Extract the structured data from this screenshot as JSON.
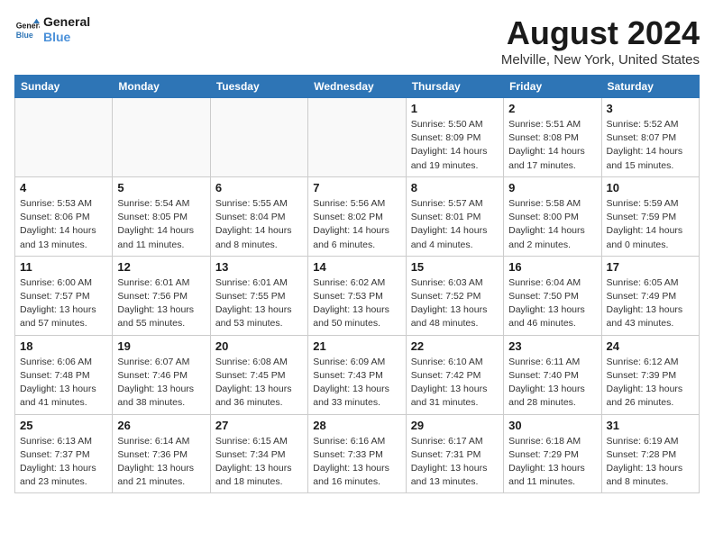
{
  "header": {
    "logo_line1": "General",
    "logo_line2": "Blue",
    "title": "August 2024",
    "subtitle": "Melville, New York, United States"
  },
  "weekdays": [
    "Sunday",
    "Monday",
    "Tuesday",
    "Wednesday",
    "Thursday",
    "Friday",
    "Saturday"
  ],
  "weeks": [
    [
      {
        "day": "",
        "info": ""
      },
      {
        "day": "",
        "info": ""
      },
      {
        "day": "",
        "info": ""
      },
      {
        "day": "",
        "info": ""
      },
      {
        "day": "1",
        "info": "Sunrise: 5:50 AM\nSunset: 8:09 PM\nDaylight: 14 hours\nand 19 minutes."
      },
      {
        "day": "2",
        "info": "Sunrise: 5:51 AM\nSunset: 8:08 PM\nDaylight: 14 hours\nand 17 minutes."
      },
      {
        "day": "3",
        "info": "Sunrise: 5:52 AM\nSunset: 8:07 PM\nDaylight: 14 hours\nand 15 minutes."
      }
    ],
    [
      {
        "day": "4",
        "info": "Sunrise: 5:53 AM\nSunset: 8:06 PM\nDaylight: 14 hours\nand 13 minutes."
      },
      {
        "day": "5",
        "info": "Sunrise: 5:54 AM\nSunset: 8:05 PM\nDaylight: 14 hours\nand 11 minutes."
      },
      {
        "day": "6",
        "info": "Sunrise: 5:55 AM\nSunset: 8:04 PM\nDaylight: 14 hours\nand 8 minutes."
      },
      {
        "day": "7",
        "info": "Sunrise: 5:56 AM\nSunset: 8:02 PM\nDaylight: 14 hours\nand 6 minutes."
      },
      {
        "day": "8",
        "info": "Sunrise: 5:57 AM\nSunset: 8:01 PM\nDaylight: 14 hours\nand 4 minutes."
      },
      {
        "day": "9",
        "info": "Sunrise: 5:58 AM\nSunset: 8:00 PM\nDaylight: 14 hours\nand 2 minutes."
      },
      {
        "day": "10",
        "info": "Sunrise: 5:59 AM\nSunset: 7:59 PM\nDaylight: 14 hours\nand 0 minutes."
      }
    ],
    [
      {
        "day": "11",
        "info": "Sunrise: 6:00 AM\nSunset: 7:57 PM\nDaylight: 13 hours\nand 57 minutes."
      },
      {
        "day": "12",
        "info": "Sunrise: 6:01 AM\nSunset: 7:56 PM\nDaylight: 13 hours\nand 55 minutes."
      },
      {
        "day": "13",
        "info": "Sunrise: 6:01 AM\nSunset: 7:55 PM\nDaylight: 13 hours\nand 53 minutes."
      },
      {
        "day": "14",
        "info": "Sunrise: 6:02 AM\nSunset: 7:53 PM\nDaylight: 13 hours\nand 50 minutes."
      },
      {
        "day": "15",
        "info": "Sunrise: 6:03 AM\nSunset: 7:52 PM\nDaylight: 13 hours\nand 48 minutes."
      },
      {
        "day": "16",
        "info": "Sunrise: 6:04 AM\nSunset: 7:50 PM\nDaylight: 13 hours\nand 46 minutes."
      },
      {
        "day": "17",
        "info": "Sunrise: 6:05 AM\nSunset: 7:49 PM\nDaylight: 13 hours\nand 43 minutes."
      }
    ],
    [
      {
        "day": "18",
        "info": "Sunrise: 6:06 AM\nSunset: 7:48 PM\nDaylight: 13 hours\nand 41 minutes."
      },
      {
        "day": "19",
        "info": "Sunrise: 6:07 AM\nSunset: 7:46 PM\nDaylight: 13 hours\nand 38 minutes."
      },
      {
        "day": "20",
        "info": "Sunrise: 6:08 AM\nSunset: 7:45 PM\nDaylight: 13 hours\nand 36 minutes."
      },
      {
        "day": "21",
        "info": "Sunrise: 6:09 AM\nSunset: 7:43 PM\nDaylight: 13 hours\nand 33 minutes."
      },
      {
        "day": "22",
        "info": "Sunrise: 6:10 AM\nSunset: 7:42 PM\nDaylight: 13 hours\nand 31 minutes."
      },
      {
        "day": "23",
        "info": "Sunrise: 6:11 AM\nSunset: 7:40 PM\nDaylight: 13 hours\nand 28 minutes."
      },
      {
        "day": "24",
        "info": "Sunrise: 6:12 AM\nSunset: 7:39 PM\nDaylight: 13 hours\nand 26 minutes."
      }
    ],
    [
      {
        "day": "25",
        "info": "Sunrise: 6:13 AM\nSunset: 7:37 PM\nDaylight: 13 hours\nand 23 minutes."
      },
      {
        "day": "26",
        "info": "Sunrise: 6:14 AM\nSunset: 7:36 PM\nDaylight: 13 hours\nand 21 minutes."
      },
      {
        "day": "27",
        "info": "Sunrise: 6:15 AM\nSunset: 7:34 PM\nDaylight: 13 hours\nand 18 minutes."
      },
      {
        "day": "28",
        "info": "Sunrise: 6:16 AM\nSunset: 7:33 PM\nDaylight: 13 hours\nand 16 minutes."
      },
      {
        "day": "29",
        "info": "Sunrise: 6:17 AM\nSunset: 7:31 PM\nDaylight: 13 hours\nand 13 minutes."
      },
      {
        "day": "30",
        "info": "Sunrise: 6:18 AM\nSunset: 7:29 PM\nDaylight: 13 hours\nand 11 minutes."
      },
      {
        "day": "31",
        "info": "Sunrise: 6:19 AM\nSunset: 7:28 PM\nDaylight: 13 hours\nand 8 minutes."
      }
    ]
  ]
}
